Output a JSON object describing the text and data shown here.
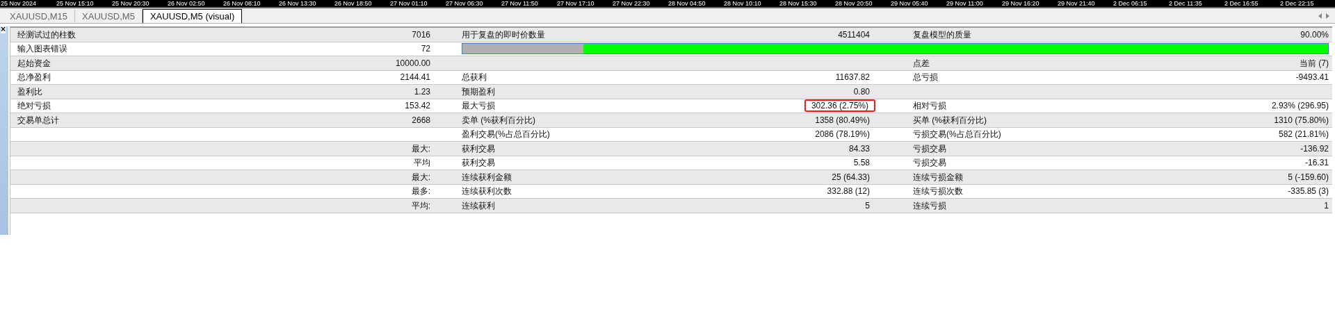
{
  "timeline": [
    "25 Nov 2024",
    "25 Nov 15:10",
    "25 Nov 20:30",
    "26 Nov 02:50",
    "26 Nov 08:10",
    "26 Nov 13:30",
    "26 Nov 18:50",
    "27 Nov 01:10",
    "27 Nov 06:30",
    "27 Nov 11:50",
    "27 Nov 17:10",
    "27 Nov 22:30",
    "28 Nov 04:50",
    "28 Nov 10:10",
    "28 Nov 15:30",
    "28 Nov 20:50",
    "29 Nov 05:40",
    "29 Nov 11:00",
    "29 Nov 16:20",
    "29 Nov 21:40",
    "2 Dec 06:15",
    "2 Dec 11:35",
    "2 Dec 16:55",
    "2 Dec 22:15"
  ],
  "tabs": [
    {
      "label": "XAUUSD,M15",
      "selected": false
    },
    {
      "label": "XAUUSD,M5",
      "selected": false
    },
    {
      "label": "XAUUSD,M5 (visual)",
      "selected": true
    }
  ],
  "close_symbol": "×",
  "rows": [
    {
      "kind": "stats",
      "cells": [
        {
          "label": "经测试过的柱数",
          "value": "7016"
        },
        {
          "label": "用于复盘的即时价数量",
          "value": "4511404"
        },
        {
          "label": "复盘模型的质量",
          "value": "90.00%"
        }
      ]
    },
    {
      "kind": "progress",
      "cells": [
        {
          "label": "输入图表错误",
          "value": "72"
        }
      ],
      "bar": {
        "level": 0.86
      }
    },
    {
      "kind": "stats",
      "cells": [
        {
          "label": "起始资金",
          "value": "10000.00"
        },
        {},
        {
          "label": "点差",
          "value": "当前 (7)"
        }
      ]
    },
    {
      "kind": "stats",
      "cells": [
        {
          "label": "总净盈利",
          "value": "2144.41"
        },
        {
          "label": "总获利",
          "value": "11637.82"
        },
        {
          "label": "总亏损",
          "value": "-9493.41"
        }
      ]
    },
    {
      "kind": "stats",
      "cells": [
        {
          "label": "盈利比",
          "value": "1.23"
        },
        {
          "label": "预期盈利",
          "value": "0.80"
        },
        {}
      ]
    },
    {
      "kind": "stats",
      "cells": [
        {
          "label": "绝对亏损",
          "value": "153.42"
        },
        {
          "label": "最大亏损",
          "value": "302.36 (2.75%)",
          "highlighted": true
        },
        {
          "label": "相对亏损",
          "value": "2.93% (296.95)"
        }
      ]
    },
    {
      "kind": "stats",
      "cells": [
        {
          "label": "交易单总计",
          "value": "2668"
        },
        {
          "label": "卖单 (%获利百分比)",
          "value": "1358 (80.49%)"
        },
        {
          "label": "买单 (%获利百分比)",
          "value": "1310 (75.80%)"
        }
      ]
    },
    {
      "kind": "stats",
      "cells": [
        {},
        {
          "label": "盈利交易(%占总百分比)",
          "value": "2086 (78.19%)"
        },
        {
          "label": "亏损交易(%占总百分比)",
          "value": "582 (21.81%)"
        }
      ]
    },
    {
      "kind": "stats",
      "cells": [
        {
          "value": "最大:"
        },
        {
          "label": "获利交易",
          "value": "84.33"
        },
        {
          "label": "亏损交易",
          "value": "-136.92"
        }
      ]
    },
    {
      "kind": "stats",
      "cells": [
        {
          "value": "平均"
        },
        {
          "label": "获利交易",
          "value": "5.58"
        },
        {
          "label": "亏损交易",
          "value": "-16.31"
        }
      ]
    },
    {
      "kind": "stats",
      "cells": [
        {
          "value": "最大:"
        },
        {
          "label": "连续获利金额",
          "value": "25 (64.33)"
        },
        {
          "label": "连续亏损金额",
          "value": "5 (-159.60)"
        }
      ]
    },
    {
      "kind": "stats",
      "cells": [
        {
          "value": "最多:"
        },
        {
          "label": "连续获利次数",
          "value": "332.88 (12)"
        },
        {
          "label": "连续亏损次数",
          "value": "-335.85 (3)"
        }
      ]
    },
    {
      "kind": "stats",
      "cells": [
        {
          "value": "平均:"
        },
        {
          "label": "连续获利",
          "value": "5"
        },
        {
          "label": "连续亏损",
          "value": "1"
        }
      ]
    }
  ]
}
